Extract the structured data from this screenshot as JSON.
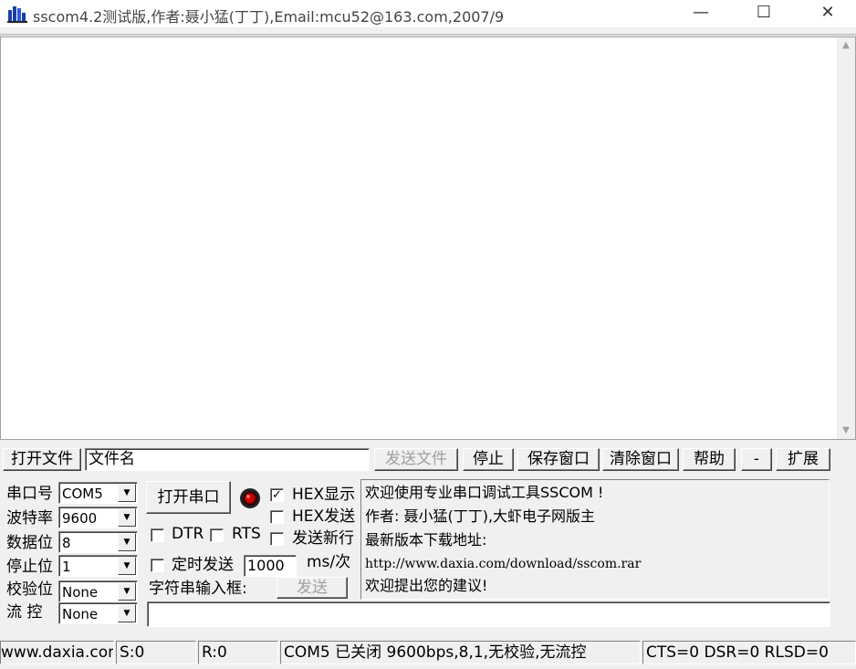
{
  "window": {
    "title": "sscom4.2测试版,作者:聂小猛(丁丁),Email:mcu52@163.com,2007/9",
    "minimize": "—",
    "maximize": "☐",
    "close": "✕"
  },
  "toolbar": {
    "open_file": "打开文件",
    "filename_value": "文件名",
    "send_file": "发送文件",
    "stop": "停止",
    "save_window": "保存窗口",
    "clear_window": "清除窗口",
    "help": "帮助",
    "minus": "-",
    "expand": "扩展"
  },
  "settings": {
    "port_label": "串口号",
    "port_value": "COM5",
    "baud_label": "波特率",
    "baud_value": "9600",
    "databits_label": "数据位",
    "databits_value": "8",
    "stopbits_label": "停止位",
    "stopbits_value": "1",
    "parity_label": "校验位",
    "parity_value": "None",
    "flow_label": "流 控",
    "flow_value": "None"
  },
  "controls": {
    "open_port": "打开串口",
    "hex_display": "HEX显示",
    "hex_display_checked": true,
    "hex_send": "HEX发送",
    "hex_send_checked": false,
    "dtr": "DTR",
    "rts": "RTS",
    "send_newline": "发送新行",
    "timed_send": "定时发送",
    "interval_value": "1000",
    "interval_unit": "ms/次",
    "input_label": "字符串输入框:",
    "send": "发送"
  },
  "info": {
    "line1": "欢迎使用专业串口调试工具SSCOM !",
    "line2": "作者: 聂小猛(丁丁),大虾电子网版主",
    "line3": "最新版本下载地址:",
    "line4": "http://www.daxia.com/download/sscom.rar",
    "line5": "欢迎提出您的建议!"
  },
  "status": {
    "website": "www.daxia.com",
    "sent": "S:0",
    "received": "R:0",
    "port_status": "COM5 已关闭  9600bps,8,1,无校验,无流控",
    "lines": "CTS=0 DSR=0 RLSD=0"
  },
  "icons": {
    "app": "sscom-app-icon",
    "led": "port-status-led-icon"
  },
  "colors": {
    "led": "#cc0000",
    "window_bg": "#f0f0f0"
  }
}
